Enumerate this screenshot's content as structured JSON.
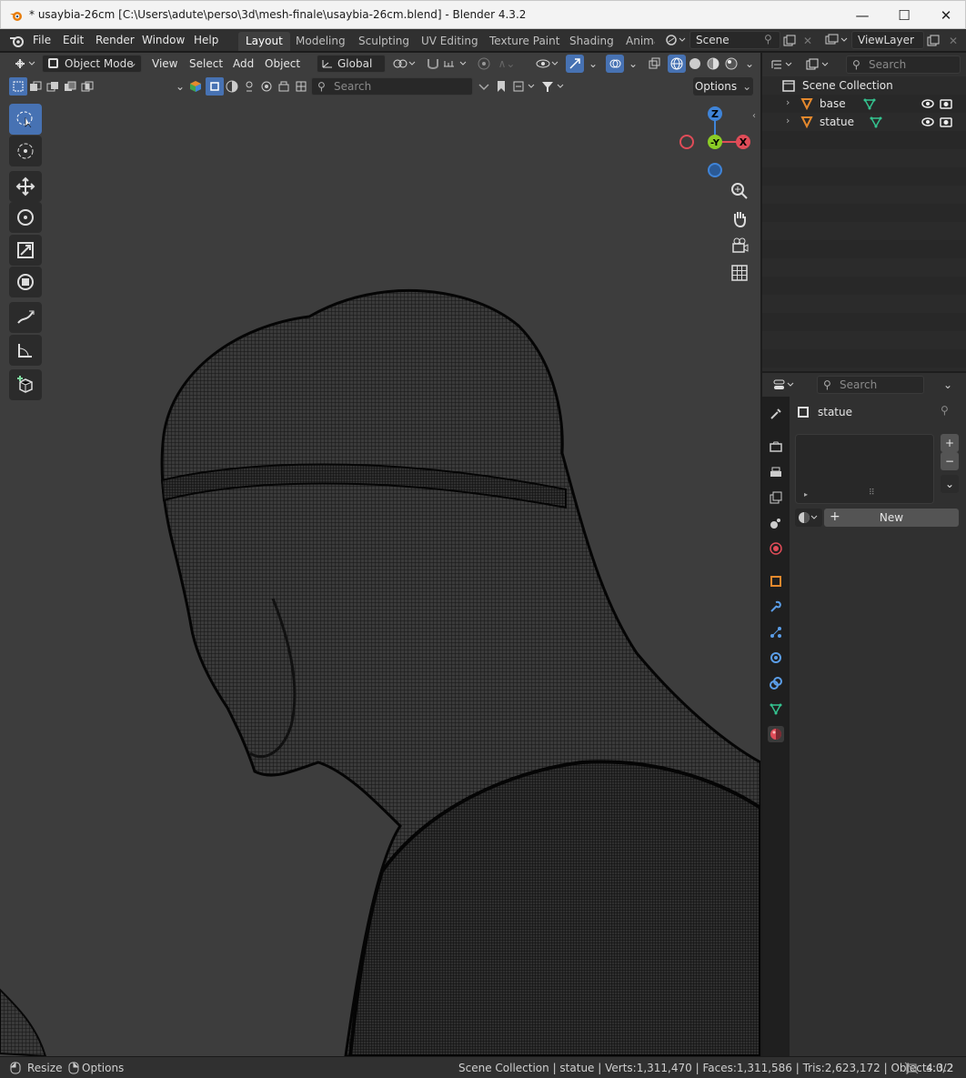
{
  "window": {
    "title": "* usaybia-26cm [C:\\Users\\adute\\perso\\3d\\mesh-finale\\usaybia-26cm.blend] - Blender 4.3.2",
    "minimize": "—",
    "maximize": "☐",
    "close": "✕"
  },
  "menubar": {
    "items": [
      "File",
      "Edit",
      "Render",
      "Window",
      "Help"
    ]
  },
  "workspaces": {
    "tabs": [
      "Layout",
      "Modeling",
      "Sculpting",
      "UV Editing",
      "Texture Paint",
      "Shading",
      "Anima"
    ],
    "active": "Layout"
  },
  "scene": {
    "name": "Scene"
  },
  "view_layer": {
    "name": "ViewLayer"
  },
  "viewport": {
    "mode": "Object Mode",
    "menus": [
      "View",
      "Select",
      "Add",
      "Object"
    ],
    "orientation": "Global",
    "search_placeholder": "Search",
    "options_label": "Options",
    "gizmo": {
      "z": "Z",
      "y": "-Y",
      "x": "X"
    }
  },
  "outliner": {
    "search_placeholder": "Search",
    "collection": "Scene Collection",
    "objects": [
      {
        "name": "base"
      },
      {
        "name": "statue"
      }
    ]
  },
  "properties": {
    "search_placeholder": "Search",
    "object_name": "statue",
    "new_button": "New"
  },
  "statusbar": {
    "resize": "Resize",
    "options": "Options",
    "stats": "Scene Collection | statue | Verts:1,311,470 | Faces:1,311,586 | Tris:2,623,172 | Objects:0/2",
    "version": "4.3.2"
  },
  "colors": {
    "accent": "#4772b3",
    "mesh_orange": "#e5892d",
    "vert_green": "#34c38f",
    "axis_x": "#e04c58",
    "axis_y": "#8ccc26",
    "axis_z": "#3f84d8"
  }
}
